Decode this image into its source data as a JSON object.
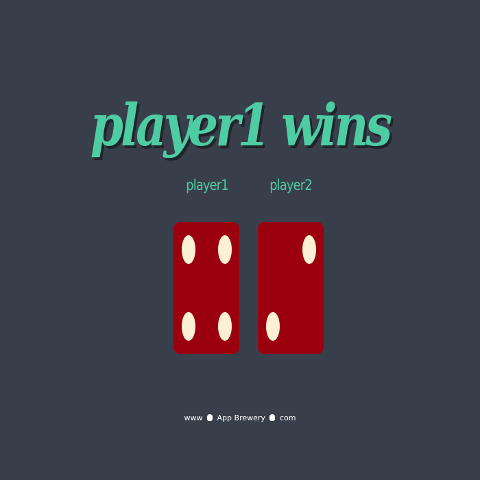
{
  "game": {
    "title": "player1 wins",
    "players": [
      {
        "label": "player1",
        "dice_value": 4
      },
      {
        "label": "player2",
        "dice_value": 2
      }
    ]
  },
  "footer": {
    "prefix": "www",
    "brand": "App Brewery",
    "suffix": "com"
  },
  "colors": {
    "background": "#393f4a",
    "accent": "#4ecca3",
    "dice": "#9b000e",
    "pip": "#fbefd4"
  }
}
